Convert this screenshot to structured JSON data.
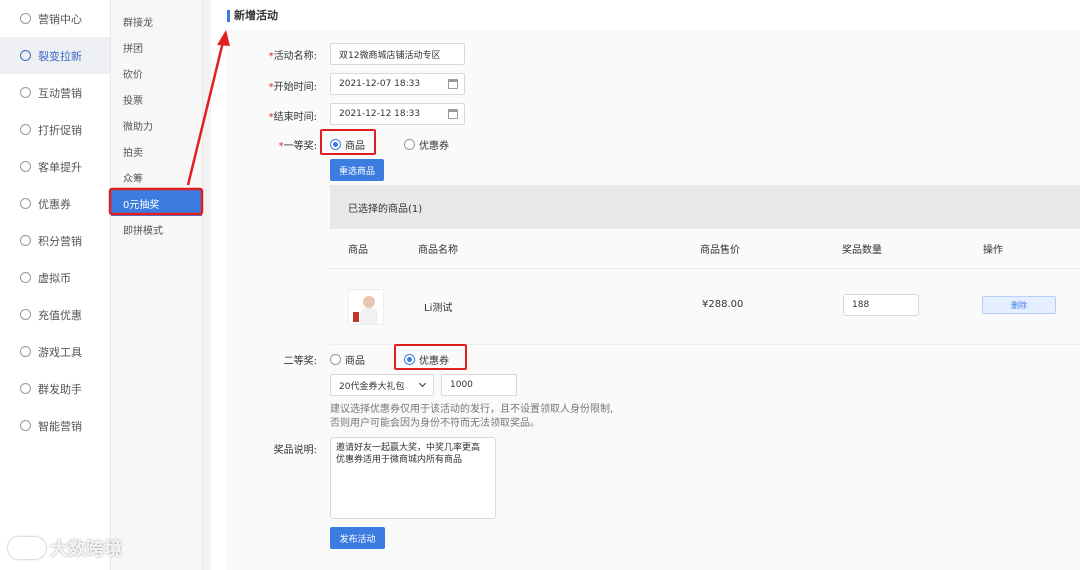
{
  "nav_primary": [
    {
      "label": "营销中心",
      "icon": "monitor-icon",
      "active": false
    },
    {
      "label": "裂变拉新",
      "icon": "fission-icon",
      "active": true
    },
    {
      "label": "互动营销",
      "icon": "paper-plane-icon",
      "active": false
    },
    {
      "label": "打折促销",
      "icon": "discount-icon",
      "active": false
    },
    {
      "label": "客单提升",
      "icon": "cart-icon",
      "active": false
    },
    {
      "label": "优惠券",
      "icon": "coupon-icon",
      "active": false
    },
    {
      "label": "积分营销",
      "icon": "points-icon",
      "active": false
    },
    {
      "label": "虚拟币",
      "icon": "coin-icon",
      "active": false
    },
    {
      "label": "充值优惠",
      "icon": "recharge-icon",
      "active": false
    },
    {
      "label": "游戏工具",
      "icon": "gamepad-icon",
      "active": false
    },
    {
      "label": "群发助手",
      "icon": "mail-icon",
      "active": false
    },
    {
      "label": "智能营销",
      "icon": "smart-icon",
      "active": false
    }
  ],
  "nav_secondary": [
    {
      "label": "群接龙",
      "active": false
    },
    {
      "label": "拼团",
      "active": false
    },
    {
      "label": "砍价",
      "active": false
    },
    {
      "label": "投票",
      "active": false
    },
    {
      "label": "微助力",
      "active": false
    },
    {
      "label": "拍卖",
      "active": false
    },
    {
      "label": "众筹",
      "active": false
    },
    {
      "label": "0元抽奖",
      "active": true
    },
    {
      "label": "即拼模式",
      "active": false
    }
  ],
  "watermark": "大数跨境",
  "page_title": "新增活动",
  "form": {
    "name_label": "活动名称:",
    "name_value": "双12微商城店铺活动专区",
    "start_label": "开始时间:",
    "start_value": "2021-12-07 18:33",
    "end_label": "结束时间:",
    "end_value": "2021-12-12 18:33",
    "required_mark": "*",
    "first_prize_label": "一等奖:",
    "first_prize_options": [
      "商品",
      "优惠券"
    ],
    "first_prize_selected": "商品",
    "reselect_button": "重选商品",
    "selected_title": "已选择的商品(1)",
    "columns": [
      "商品",
      "商品名称",
      "商品售价",
      "奖品数量",
      "操作"
    ],
    "product": {
      "name": "Li测试",
      "price": "¥288.00",
      "quantity": "188",
      "delete_label": "删除"
    },
    "second_prize_label": "二等奖:",
    "second_prize_options": [
      "商品",
      "优惠券"
    ],
    "second_prize_selected": "优惠券",
    "coupon_select": "20代金券大礼包",
    "coupon_count": "1000",
    "hint_line1": "建议选择优惠券仅用于该活动的发行，且不设置领取人身份限制,",
    "hint_line2": "否则用户可能会因为身份不符而无法领取奖品。",
    "desc_label": "奖品说明:",
    "desc_line1": "邀请好友一起赢大奖，中奖几率更高",
    "desc_line2": "优惠券适用于微商城内所有商品",
    "publish_button": "发布活动"
  },
  "colors": {
    "accent": "#3c7be0",
    "highlight": "#e02020"
  }
}
